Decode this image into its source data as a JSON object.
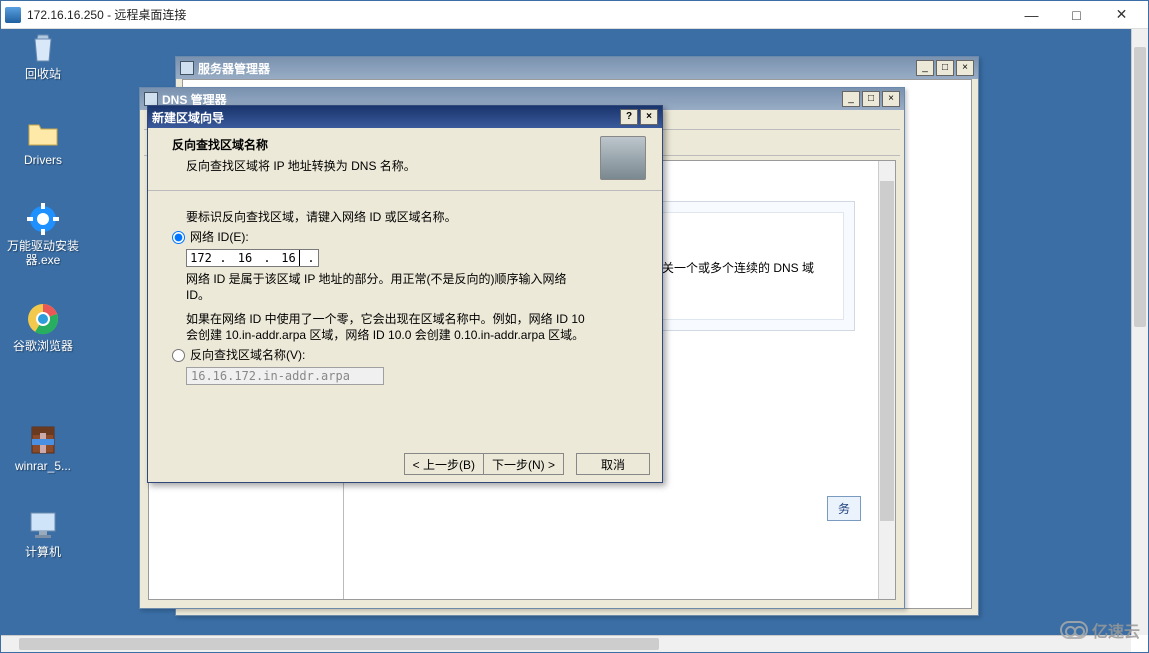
{
  "rdp": {
    "title": "172.16.16.250 - 远程桌面连接",
    "min": "—",
    "max": "□",
    "close": "✕"
  },
  "desktop_icons": {
    "recycle": "回收站",
    "drivers": "Drivers",
    "driver_exe": "万能驱动安装器.exe",
    "chrome": "谷歌浏览器",
    "winrar": "winrar_5...",
    "computer": "计算机"
  },
  "server_manager": {
    "title": "服务器管理器",
    "min": "_",
    "max": "□",
    "close": "×"
  },
  "dns_manager": {
    "title": "DNS 管理器",
    "min": "_",
    "max": "□",
    "close": "×",
    "text_a": "域存储有关一个或多个连续的 DNS 域",
    "text_b": "。",
    "svc_btn": "务"
  },
  "wizard": {
    "title": "新建区域向导",
    "help": "?",
    "close": "×",
    "header_h1": "反向查找区域名称",
    "header_h2": "反向查找区域将 IP 地址转换为 DNS 名称。",
    "intro": "要标识反向查找区域，请键入网络 ID 或区域名称。",
    "opt1_label": "网络 ID(E):",
    "ip_oct1": "172",
    "ip_oct2": "16",
    "ip_oct3": "16",
    "ip_oct4": "",
    "help1": "网络 ID 是属于该区域 IP 地址的部分。用正常(不是反向的)顺序输入网络 ID。",
    "help2": "如果在网络 ID 中使用了一个零，它会出现在区域名称中。例如，网络 ID 10 会创建 10.in-addr.arpa 区域，网络 ID 10.0 会创建 0.10.in-addr.arpa 区域。",
    "opt2_label": "反向查找区域名称(V):",
    "zone_name_value": "16.16.172.in-addr.arpa",
    "btn_back": "< 上一步(B)",
    "btn_next": "下一步(N) >",
    "btn_cancel": "取消"
  },
  "watermark": "亿速云"
}
